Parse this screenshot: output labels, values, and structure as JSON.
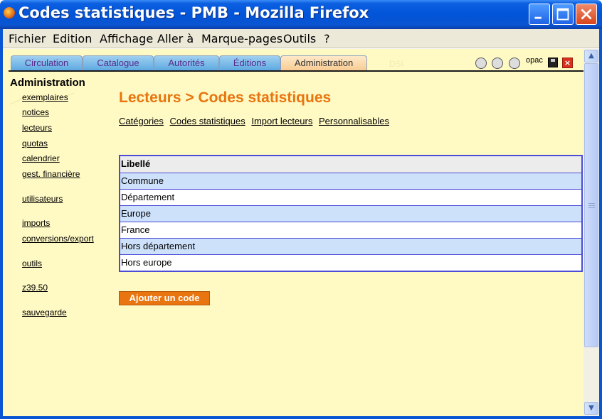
{
  "window": {
    "title": "Codes statistiques - PMB - Mozilla Firefox"
  },
  "menubar": {
    "items": [
      {
        "label": "Fichier"
      },
      {
        "label": "Edition"
      },
      {
        "label": "Affichage"
      },
      {
        "label": "Aller à"
      },
      {
        "label": "Marque-pages"
      },
      {
        "label": "Outils"
      },
      {
        "label": "?"
      }
    ]
  },
  "tabs": [
    {
      "label": "Circulation"
    },
    {
      "label": "Catalogue"
    },
    {
      "label": "Autorités"
    },
    {
      "label": "Éditions"
    },
    {
      "label": "Administration",
      "active": true
    }
  ],
  "toolbar": {
    "ghost_label": "DSI",
    "opac_label": "opac"
  },
  "sidebar": {
    "title": "Administration",
    "items": [
      {
        "label": "exemplaires"
      },
      {
        "label": "notices"
      },
      {
        "label": "lecteurs"
      },
      {
        "label": "quotas"
      },
      {
        "label": "calendrier"
      },
      {
        "label": "gest. financière"
      },
      {
        "label": "utilisateurs"
      },
      {
        "label": "imports"
      },
      {
        "label": "conversions/export"
      },
      {
        "label": "outils"
      },
      {
        "label": "z39.50"
      },
      {
        "label": "sauvegarde"
      }
    ]
  },
  "main": {
    "title": "Lecteurs > Codes statistiques",
    "sublinks": [
      {
        "label": "Catégories"
      },
      {
        "label": "Codes statistiques"
      },
      {
        "label": "Import lecteurs"
      },
      {
        "label": "Personnalisables"
      }
    ],
    "table": {
      "header": "Libellé",
      "rows": [
        "Commune",
        "Département",
        "Europe",
        "France",
        "Hors département",
        "Hors europe"
      ]
    },
    "add_button": "Ajouter un code"
  },
  "colors": {
    "accent": "#e8750f",
    "content_bg": "#fff9c4",
    "row_alt": "#cde1fa",
    "table_border": "#4b4bd6"
  }
}
